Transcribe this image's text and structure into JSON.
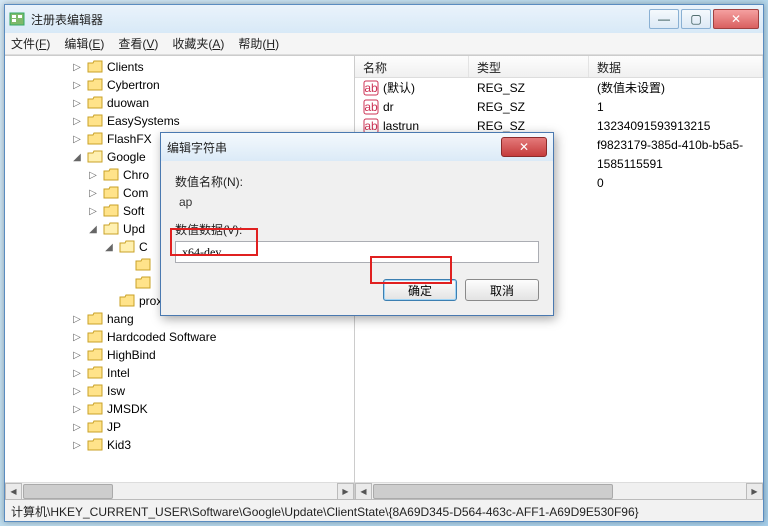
{
  "window": {
    "title": "注册表编辑器",
    "status_path": "计算机\\HKEY_CURRENT_USER\\Software\\Google\\Update\\ClientState\\{8A69D345-D564-463c-AFF1-A69D9E530F96}"
  },
  "win_buttons": {
    "min": "—",
    "max": "▢",
    "close": "✕"
  },
  "menu": [
    {
      "label": "文件",
      "hotkey": "F"
    },
    {
      "label": "编辑",
      "hotkey": "E"
    },
    {
      "label": "查看",
      "hotkey": "V"
    },
    {
      "label": "收藏夹",
      "hotkey": "A"
    },
    {
      "label": "帮助",
      "hotkey": "H"
    }
  ],
  "tree": [
    {
      "depth": 3,
      "exp": "▷",
      "label": "Clients"
    },
    {
      "depth": 3,
      "exp": "▷",
      "label": "Cybertron"
    },
    {
      "depth": 3,
      "exp": "▷",
      "label": "duowan"
    },
    {
      "depth": 3,
      "exp": "▷",
      "label": "EasySystems"
    },
    {
      "depth": 3,
      "exp": "▷",
      "label": "FlashFX"
    },
    {
      "depth": 3,
      "exp": "◢",
      "label": "Google"
    },
    {
      "depth": 4,
      "exp": "▷",
      "label": "Chro"
    },
    {
      "depth": 4,
      "exp": "▷",
      "label": "Com"
    },
    {
      "depth": 4,
      "exp": "▷",
      "label": "Soft"
    },
    {
      "depth": 4,
      "exp": "◢",
      "label": "Upd"
    },
    {
      "depth": 5,
      "exp": "◢",
      "label": "C"
    },
    {
      "depth": 6,
      "exp": "",
      "label": ""
    },
    {
      "depth": 6,
      "exp": "",
      "label": ""
    },
    {
      "depth": 5,
      "exp": "",
      "label": "proxy"
    },
    {
      "depth": 3,
      "exp": "▷",
      "label": "hang"
    },
    {
      "depth": 3,
      "exp": "▷",
      "label": "Hardcoded Software"
    },
    {
      "depth": 3,
      "exp": "▷",
      "label": "HighBind"
    },
    {
      "depth": 3,
      "exp": "▷",
      "label": "Intel"
    },
    {
      "depth": 3,
      "exp": "▷",
      "label": "Isw"
    },
    {
      "depth": 3,
      "exp": "▷",
      "label": "JMSDK"
    },
    {
      "depth": 3,
      "exp": "▷",
      "label": "JP"
    },
    {
      "depth": 3,
      "exp": "▷",
      "label": "Kid3"
    }
  ],
  "list_headers": {
    "name": "名称",
    "type": "类型",
    "data": "数据"
  },
  "values": [
    {
      "name": "(默认)",
      "type": "REG_SZ",
      "data": "(数值未设置)"
    },
    {
      "name": "dr",
      "type": "REG_SZ",
      "data": "1"
    },
    {
      "name": "lastrun",
      "type": "REG_SZ",
      "data": "13234091593913215"
    },
    {
      "name": "",
      "type": "",
      "data": "f9823179-385d-410b-b5a5-"
    },
    {
      "name": "",
      "type": "",
      "data": "1585115591"
    },
    {
      "name": "",
      "type": "",
      "data": "0"
    }
  ],
  "dialog": {
    "title": "编辑字符串",
    "name_label": "数值名称(N):",
    "name_value": "ap",
    "data_label": "数值数据(V):",
    "data_value": "x64-dev",
    "ok": "确定",
    "cancel": "取消",
    "close": "✕"
  }
}
